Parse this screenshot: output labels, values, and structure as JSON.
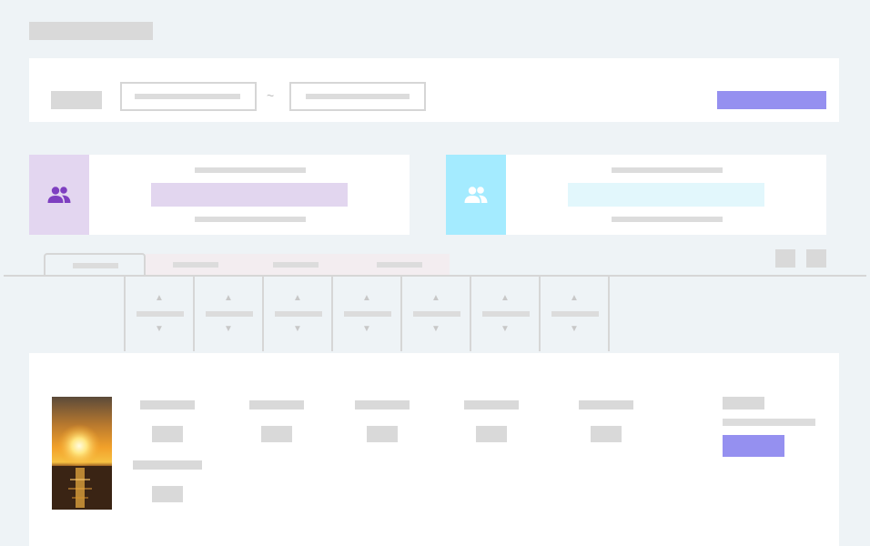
{
  "header": {
    "title_placeholder": "",
    "icon": "none"
  },
  "filter": {
    "label": "",
    "date_from": "",
    "date_to": "",
    "range_separator": "~",
    "submit_label": ""
  },
  "cards": [
    {
      "icon": "users-icon",
      "accent": "#7e3fc0",
      "bg": "#e3d6f0",
      "bar_bg": "#e2d6ef"
    },
    {
      "icon": "users-icon",
      "accent": "#ffffff",
      "bg": "#a4ebff",
      "bar_bg": "#e2f7fc"
    }
  ],
  "tabs": [
    {
      "label": "",
      "active": true
    },
    {
      "label": "",
      "active": false
    },
    {
      "label": "",
      "active": false
    },
    {
      "label": "",
      "active": false
    }
  ],
  "sort_columns": [
    {
      "up": "▲",
      "down": "▼"
    },
    {
      "up": "▲",
      "down": "▼"
    },
    {
      "up": "▲",
      "down": "▼"
    },
    {
      "up": "▲",
      "down": "▼"
    },
    {
      "up": "▲",
      "down": "▼"
    },
    {
      "up": "▲",
      "down": "▼"
    },
    {
      "up": "▲",
      "down": "▼"
    }
  ],
  "list_item": {
    "thumbnail": "sunset-image",
    "action_label": ""
  },
  "colors": {
    "page_bg": "#eef3f6",
    "primary": "#9590f0",
    "skeleton": "#d9d9d9"
  }
}
